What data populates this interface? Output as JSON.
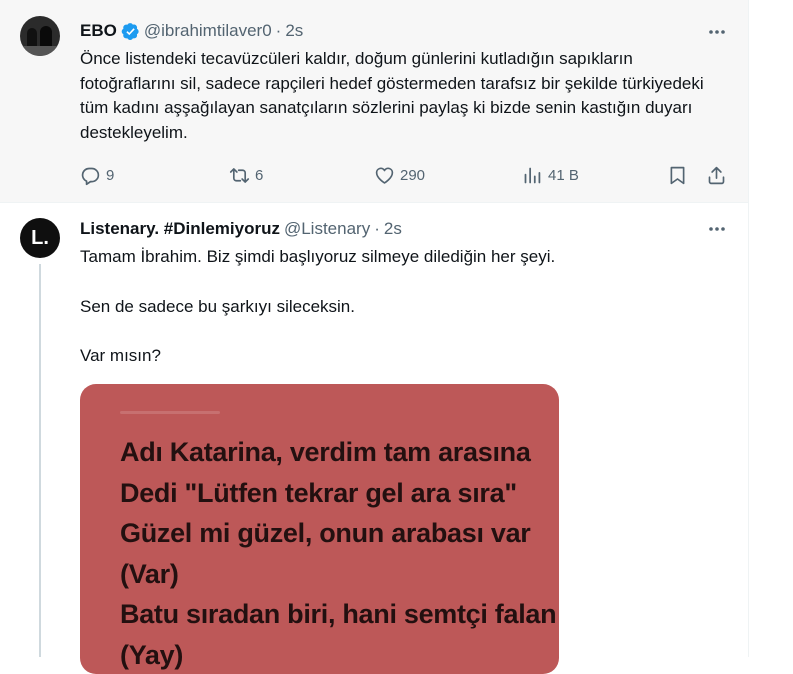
{
  "tweet1": {
    "name": "EBO",
    "handle": "@ibrahimtilaver0",
    "separator": "·",
    "time": "2s",
    "text": "Önce listendeki tecavüzcüleri kaldır, doğum günlerini kutladığın sapıkların fotoğraflarını sil, sadece rapçileri hedef göstermeden tarafsız bir şekilde türkiyedeki tüm kadını aşşağılayan sanatçıların sözlerini paylaş ki bizde senin kastığın duyarı destekleyelim.",
    "replies": "9",
    "reposts": "6",
    "likes": "290",
    "views": "41 B",
    "verified_color": "#1d9bf0",
    "icons": [
      "verified-badge-icon",
      "more-icon",
      "reply-icon",
      "repost-icon",
      "like-icon",
      "views-icon",
      "bookmark-icon",
      "share-icon"
    ]
  },
  "tweet2": {
    "avatar_text": "L.",
    "name": "Listenary. #Dinlemiyoruz",
    "handle": "@Listenary",
    "separator": "·",
    "time": "2s",
    "lines": [
      "Tamam İbrahim. Biz şimdi başlıyoruz silmeye dilediğin her şeyi.",
      "Sen de sadece bu şarkıyı sileceksin.",
      "Var mısın?"
    ],
    "media": {
      "background": "#bd5858",
      "lyrics": [
        "Adı Katarina, verdim tam arasına",
        "Dedi \"Lütfen tekrar gel ara sıra\"",
        "Güzel mi güzel, onun arabası var",
        "(Var)",
        "Batu sıradan biri, hani semtçi falan",
        "(Yay)"
      ]
    }
  }
}
